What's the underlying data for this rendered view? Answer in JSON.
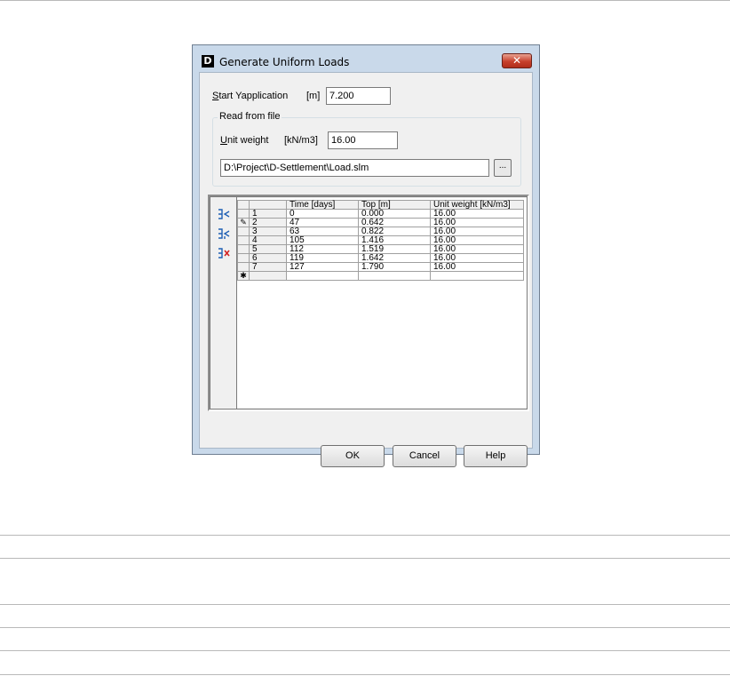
{
  "window": {
    "title": "Generate Uniform Loads",
    "app_icon_letter": "D",
    "close_glyph": "✕"
  },
  "start_y": {
    "label_prefix": "S",
    "label_rest": "tart Yapplication",
    "unit": "[m]",
    "value": "7.200"
  },
  "read_from_file": {
    "legend": "Read from file",
    "unit_weight_label_prefix": "U",
    "unit_weight_label_rest": "nit weight",
    "unit_weight_unit": "[kN/m3]",
    "unit_weight_value": "16.00",
    "file_path": "D:\\Project\\D-Settlement\\Load.slm",
    "browse_label": "..."
  },
  "toolbar_icons": [
    "insert-row-icon",
    "add-row-icon",
    "delete-row-icon"
  ],
  "table": {
    "headers": [
      "Time [days]",
      "Top [m]",
      "Unit weight [kN/m3]"
    ],
    "rows": [
      {
        "n": "1",
        "time": "0",
        "top": "0.000",
        "uw": "16.00"
      },
      {
        "n": "2",
        "time": "47",
        "top": "0.642",
        "uw": "16.00"
      },
      {
        "n": "3",
        "time": "63",
        "top": "0.822",
        "uw": "16.00"
      },
      {
        "n": "4",
        "time": "105",
        "top": "1.416",
        "uw": "16.00"
      },
      {
        "n": "5",
        "time": "112",
        "top": "1.519",
        "uw": "16.00"
      },
      {
        "n": "6",
        "time": "119",
        "top": "1.642",
        "uw": "16.00"
      },
      {
        "n": "7",
        "time": "127",
        "top": "1.790",
        "uw": "16.00"
      }
    ],
    "edit_indicator": "✎",
    "new_row_indicator": "✱"
  },
  "buttons": {
    "ok": "OK",
    "cancel": "Cancel",
    "help": "Help"
  }
}
